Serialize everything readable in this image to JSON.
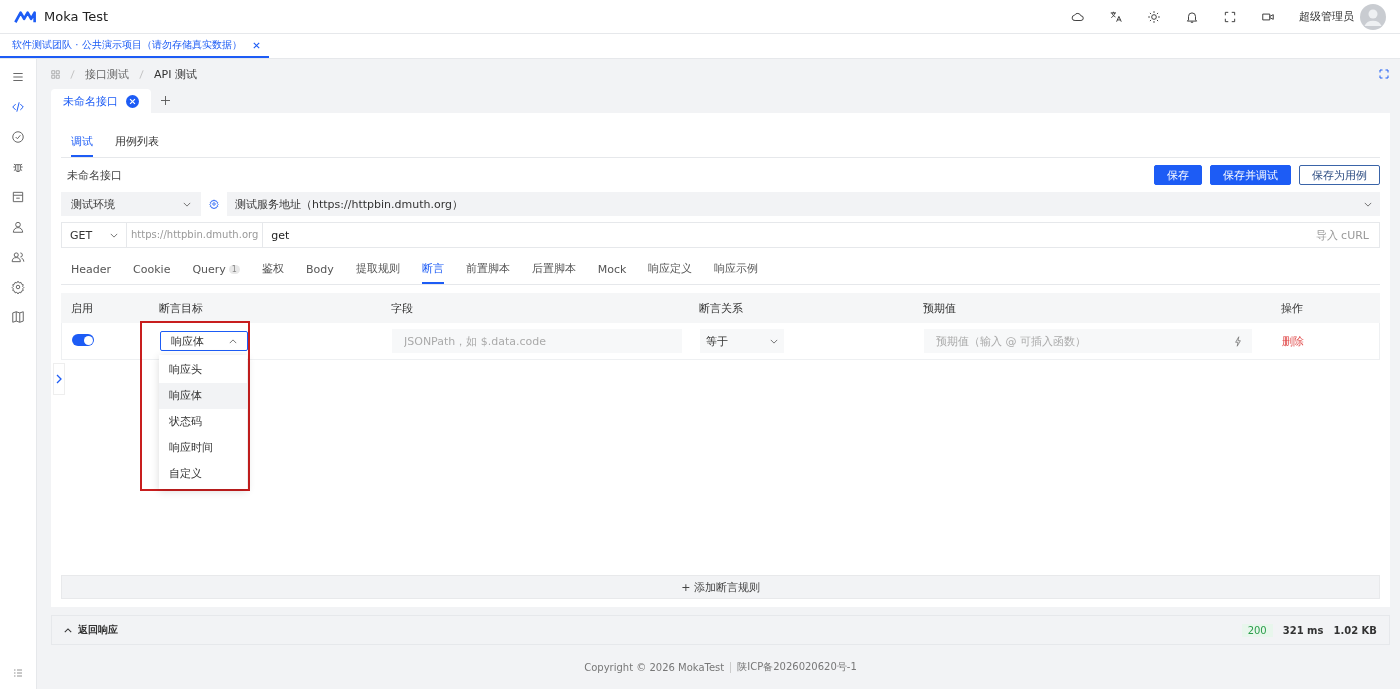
{
  "app": {
    "name": "Moka Test"
  },
  "user": {
    "name": "超级管理员"
  },
  "project_tab": {
    "label": "软件测试团队 · 公共演示项目（请勿存储真实数据）",
    "selected": true
  },
  "sidebar": {
    "items": [
      {
        "selected": false
      },
      {
        "selected": true
      },
      {
        "selected": false
      },
      {
        "selected": false
      },
      {
        "selected": false
      },
      {
        "selected": false
      },
      {
        "selected": false
      },
      {
        "selected": false
      },
      {
        "selected": false
      }
    ]
  },
  "breadcrumb": [
    "接口测试",
    "API 测试"
  ],
  "interface_tabs": [
    {
      "label": "未命名接口",
      "selected": true
    }
  ],
  "mode_tabs": [
    {
      "label": "调试",
      "selected": true
    },
    {
      "label": "用例列表",
      "selected": false
    }
  ],
  "interface_name": "未命名接口",
  "buttons": [
    {
      "label": "保存",
      "kind": "primary"
    },
    {
      "label": "保存并调试",
      "kind": "primary"
    },
    {
      "label": "保存为用例",
      "kind": "outline"
    }
  ],
  "environment": {
    "value": "测试环境",
    "server": "测试服务地址（https://httpbin.dmuth.org）"
  },
  "request": {
    "method": "GET",
    "base_url": "https://httpbin.dmuth.org",
    "path": "get",
    "import": "导入 cURL"
  },
  "request_tabs": [
    {
      "label": "Header",
      "selected": false
    },
    {
      "label": "Cookie",
      "selected": false
    },
    {
      "label": "Query",
      "badge": "1",
      "selected": false
    },
    {
      "label": "鉴权",
      "selected": false
    },
    {
      "label": "Body",
      "selected": false
    },
    {
      "label": "提取规则",
      "selected": false
    },
    {
      "label": "断言",
      "selected": true
    },
    {
      "label": "前置脚本",
      "selected": false
    },
    {
      "label": "后置脚本",
      "selected": false
    },
    {
      "label": "Mock",
      "selected": false
    },
    {
      "label": "响应定义",
      "selected": false
    },
    {
      "label": "响应示例",
      "selected": false
    }
  ],
  "assertions": {
    "columns": [
      "启用",
      "断言目标",
      "字段",
      "断言关系",
      "预期值",
      "操作"
    ],
    "rows": [
      {
        "enabled": true,
        "target": "响应体",
        "field_placeholder": "JSONPath，如 $.data.code",
        "relation": "等于",
        "expected_placeholder": "预期值（输入 @ 可插入函数）",
        "action": "删除"
      }
    ],
    "add": "+ 添加断言规则"
  },
  "target_dropdown": {
    "expanded": true,
    "options": [
      {
        "label": "响应头",
        "selected": false
      },
      {
        "label": "响应体",
        "selected": true
      },
      {
        "label": "状态码",
        "selected": false
      },
      {
        "label": "响应时间",
        "selected": false
      },
      {
        "label": "自定义",
        "selected": false
      }
    ]
  },
  "response": {
    "label": "返回响应",
    "status": "200",
    "time": "321 ms",
    "size": "1.02 KB"
  },
  "footer": {
    "copyright": "Copyright © 2026 MokaTest",
    "icp": "陕ICP备2026020620号-1"
  }
}
